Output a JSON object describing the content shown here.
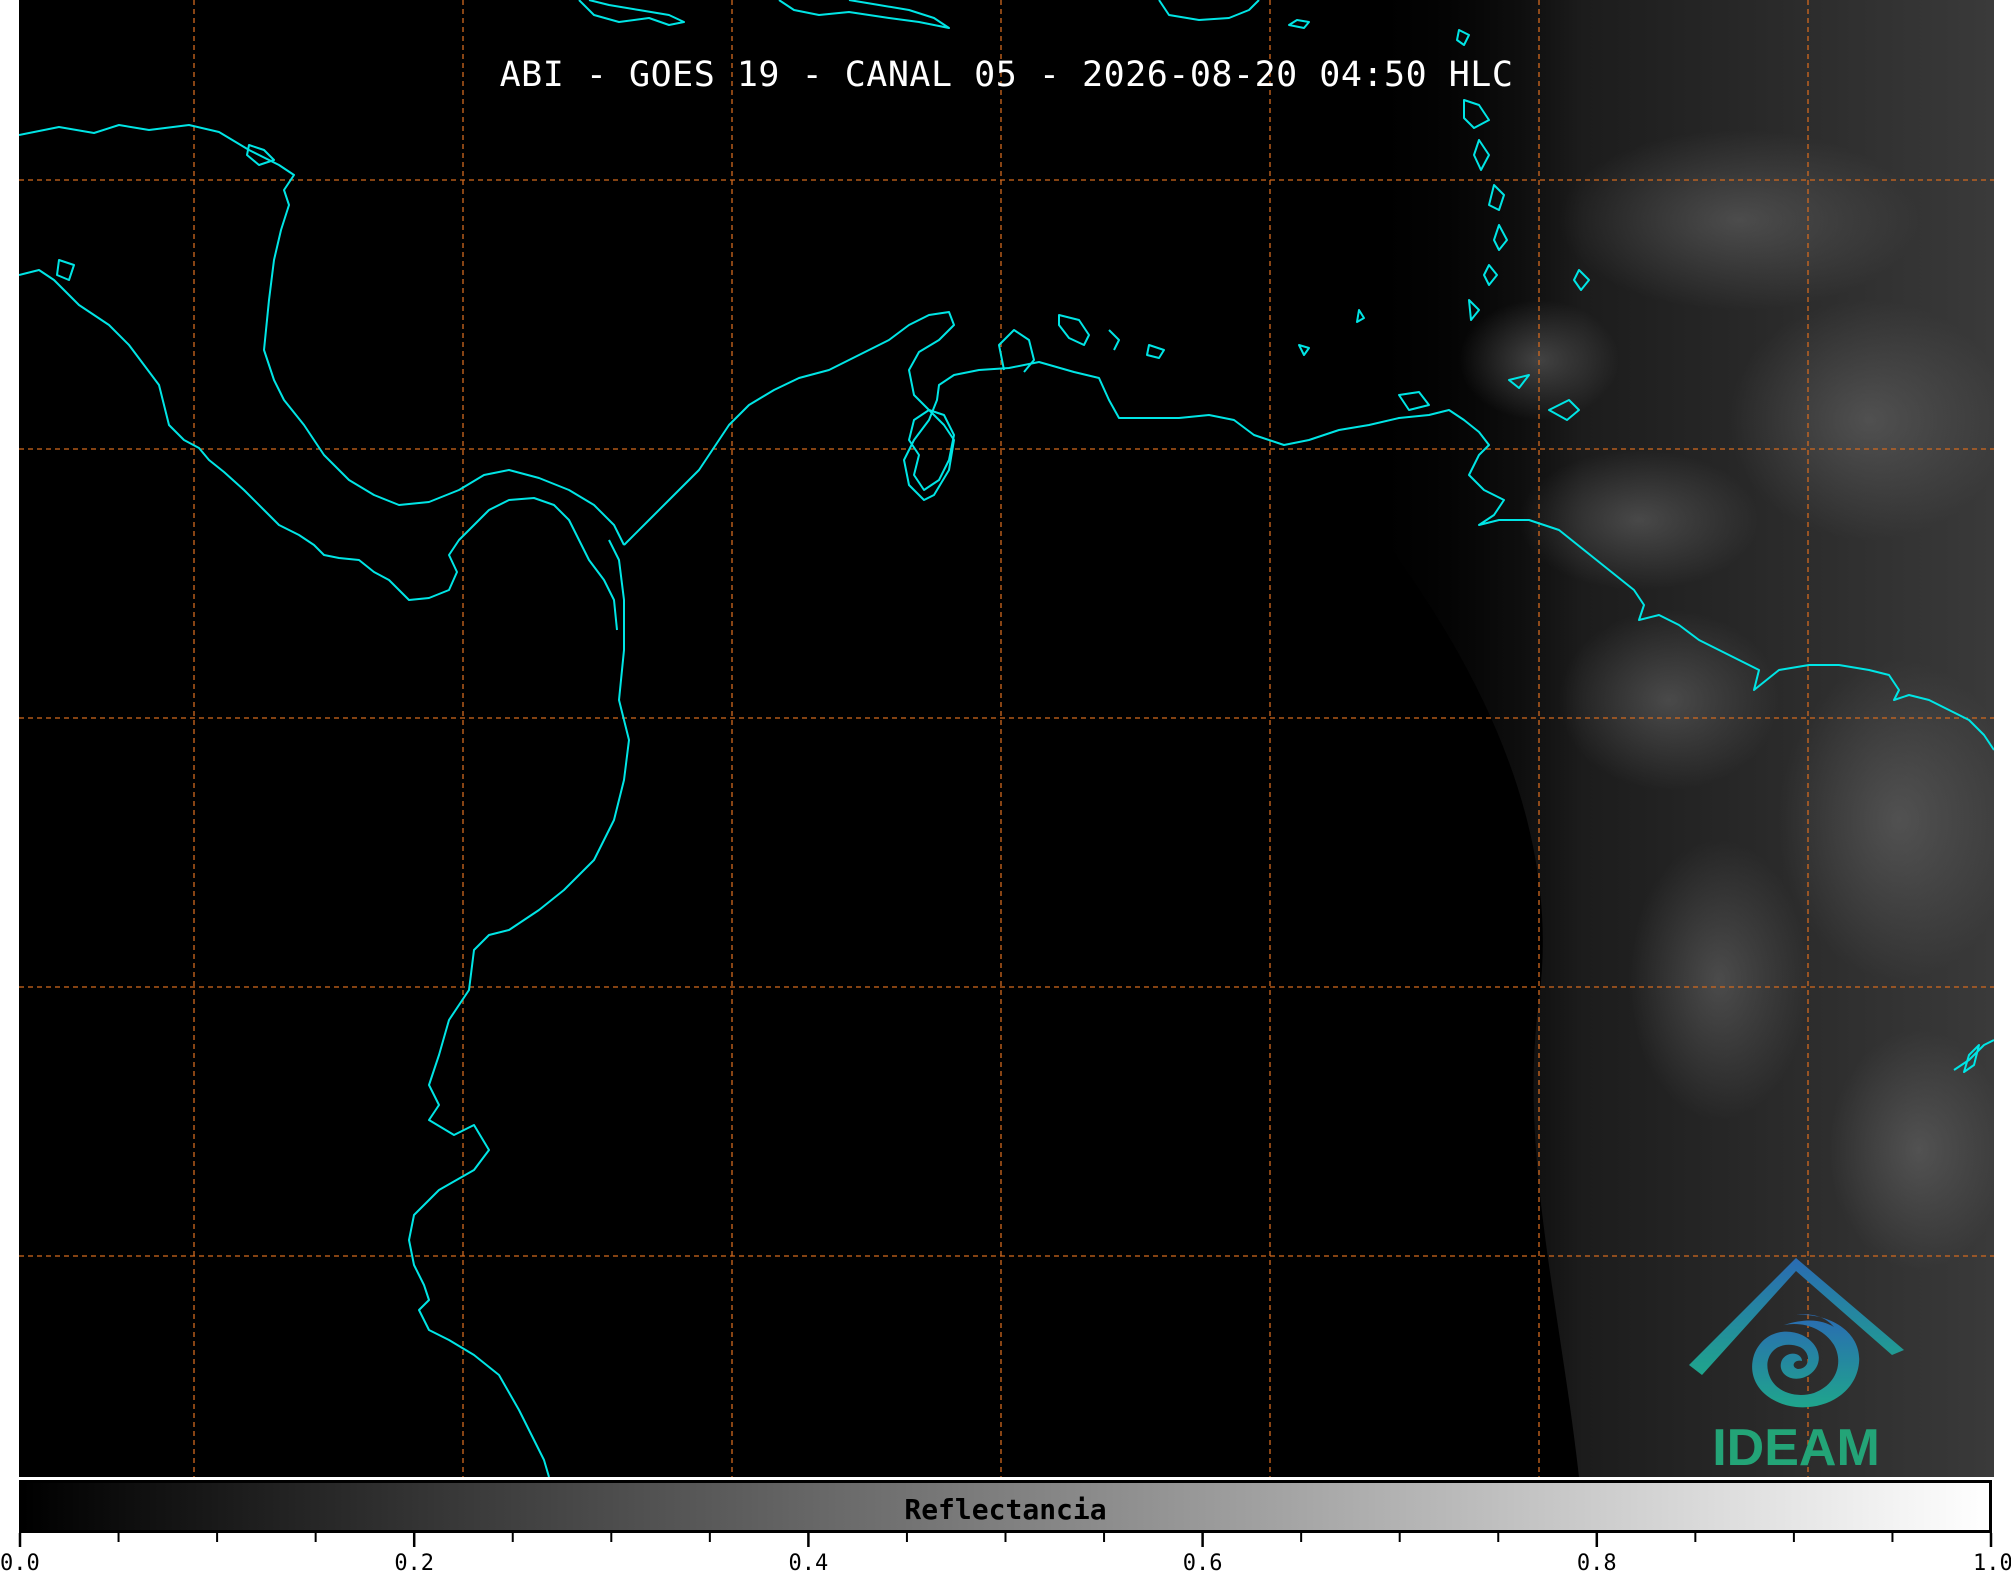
{
  "title": "ABI - GOES 19 - CANAL 05 - 2026-08-20 04:50 HLC",
  "logo": {
    "text": "IDEAM",
    "colors": {
      "blue": "#2a6bb3",
      "teal": "#1fa58c",
      "text": "#23a477"
    }
  },
  "colorbar": {
    "label": "Reflectancia",
    "range": [
      0.0,
      1.0
    ],
    "tick_labels": [
      "0.0",
      "0.2",
      "0.4",
      "0.6",
      "0.8",
      "1.0"
    ],
    "minor_step": 0.05
  },
  "colors": {
    "coastline": "#00e5e5",
    "gridline": "#d2691e",
    "background": "#000000"
  }
}
